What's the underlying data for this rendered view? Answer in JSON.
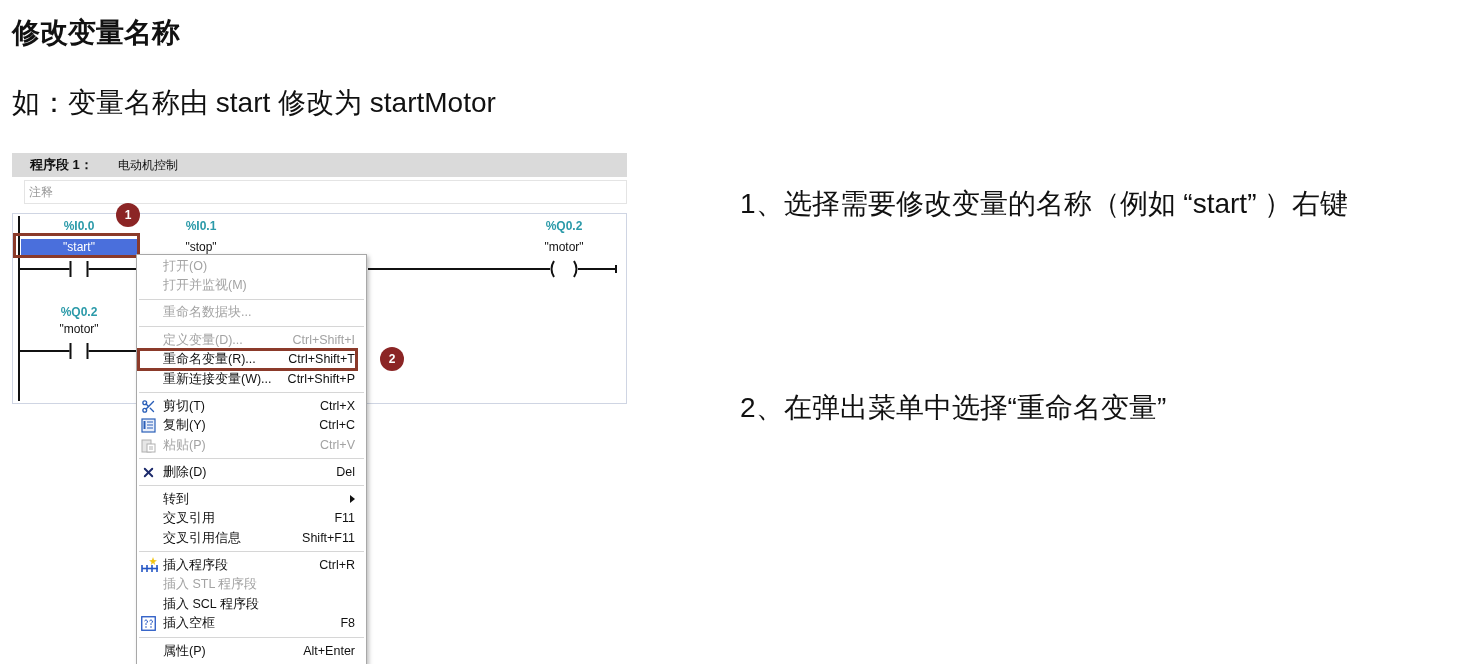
{
  "title": "修改变量名称",
  "example": "如：变量名称由 start 修改为 startMotor",
  "editor": {
    "network_label": "程序段 1：",
    "network_title": "电动机控制",
    "comment": {
      "placeholder": "注释"
    },
    "rungs": [
      {
        "elements": [
          {
            "kind": "contact",
            "address": "%I0.0",
            "name": "\"start\"",
            "selected": true,
            "callout": "1"
          },
          {
            "kind": "contact",
            "address": "%I0.1",
            "name": "\"stop\"",
            "selected": false
          },
          {
            "kind": "coil",
            "address": "%Q0.2",
            "name": "\"motor\"",
            "selected": false
          }
        ]
      },
      {
        "elements": [
          {
            "kind": "contact",
            "address": "%Q0.2",
            "name": "\"motor\"",
            "selected": false
          }
        ]
      }
    ],
    "context_menu": {
      "groups": [
        [
          {
            "label": "打开(O)",
            "disabled": true,
            "submenu": false
          },
          {
            "label": "打开并监视(M)",
            "disabled": true,
            "submenu": false
          }
        ],
        [
          {
            "label": "重命名数据块...",
            "disabled": true,
            "submenu": false
          }
        ],
        [
          {
            "label": "定义变量(D)...",
            "shortcut": "Ctrl+Shift+I",
            "disabled": true,
            "submenu": false
          },
          {
            "label": "重命名变量(R)...",
            "shortcut": "Ctrl+Shift+T",
            "disabled": false,
            "submenu": false,
            "callout": "2"
          },
          {
            "label": "重新连接变量(W)...",
            "shortcut": "Ctrl+Shift+P",
            "disabled": false,
            "submenu": false
          }
        ],
        [
          {
            "label": "剪切(T)",
            "shortcut": "Ctrl+X",
            "disabled": false,
            "submenu": false
          },
          {
            "label": "复制(Y)",
            "shortcut": "Ctrl+C",
            "disabled": false,
            "submenu": false
          },
          {
            "label": "粘贴(P)",
            "shortcut": "Ctrl+V",
            "disabled": true,
            "submenu": false
          }
        ],
        [
          {
            "label": "删除(D)",
            "shortcut": "Del",
            "disabled": false,
            "submenu": false
          }
        ],
        [
          {
            "label": "转到",
            "disabled": false,
            "submenu": true
          },
          {
            "label": "交叉引用",
            "shortcut": "F11",
            "disabled": false,
            "submenu": false
          },
          {
            "label": "交叉引用信息",
            "shortcut": "Shift+F11",
            "disabled": false,
            "submenu": false
          }
        ],
        [
          {
            "label": "插入程序段",
            "shortcut": "Ctrl+R",
            "disabled": false,
            "submenu": false
          },
          {
            "label": "插入 STL 程序段",
            "disabled": true,
            "submenu": false
          },
          {
            "label": "插入 SCL 程序段",
            "disabled": false,
            "submenu": false
          },
          {
            "label": "插入空框",
            "shortcut": "F8",
            "disabled": false,
            "submenu": false
          }
        ],
        [
          {
            "label": "属性(P)",
            "shortcut": "Alt+Enter",
            "disabled": false,
            "submenu": false
          }
        ]
      ]
    }
  },
  "steps": [
    "1、选择需要修改变量的名称（例如 “start” ）右键",
    "2、在弹出菜单中选择“重命名变量”"
  ]
}
